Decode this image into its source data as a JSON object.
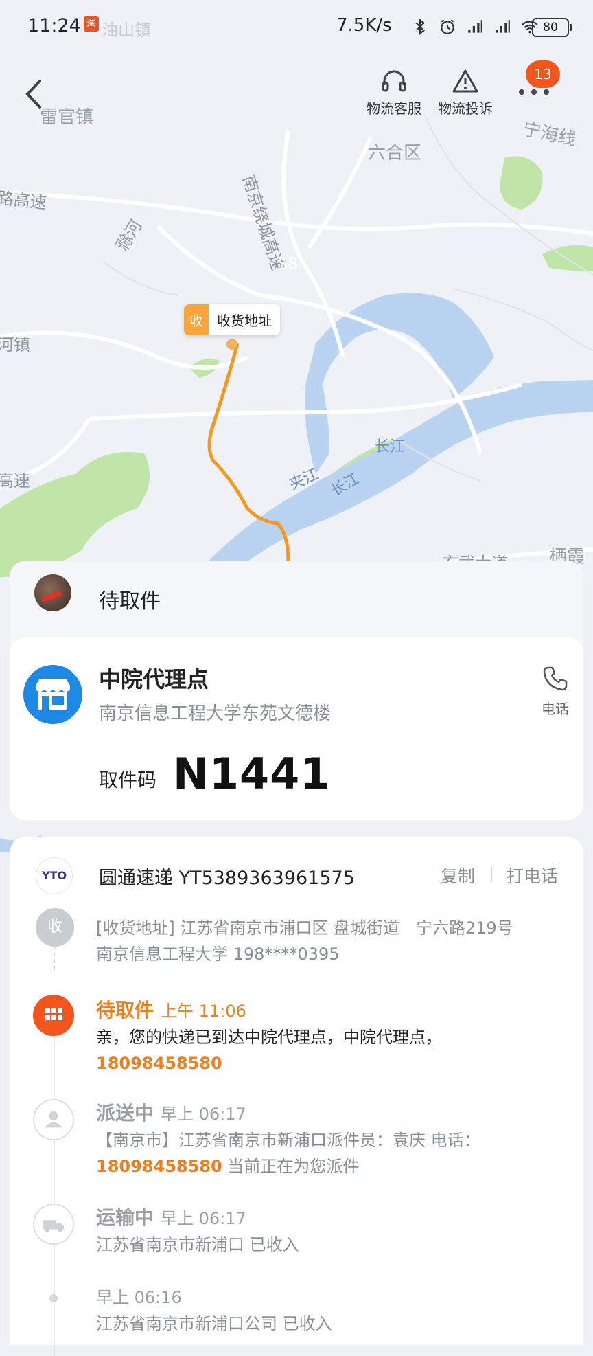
{
  "status_bar": {
    "time": "11:24",
    "app_icon": "淘",
    "faded_text": "油山镇",
    "net_speed": "7.5K/s",
    "battery": "80"
  },
  "nav": {
    "service_label": "物流客服",
    "complaint_label": "物流投诉",
    "badge_count": "13"
  },
  "map": {
    "labels": [
      "雷官镇",
      "南京绕城高速",
      "六合区",
      "宁海线",
      "路高速",
      "滁河",
      "S8",
      "河镇",
      "长江",
      "夹江",
      "长江",
      "高速",
      "栖霞",
      "玄武大道"
    ],
    "pin_tag": "收",
    "pin_text": "收货地址"
  },
  "status": {
    "title": "待取件"
  },
  "station": {
    "name": "中院代理点",
    "address": "南京信息工程大学东苑文德楼",
    "phone_label": "电话",
    "code_label": "取件码",
    "code": "N1441"
  },
  "tracking": {
    "carrier_logo": "YTO",
    "carrier": "圆通速递 YT5389363961575",
    "copy": "复制",
    "call": "打电话",
    "receive_tag": "收",
    "receive_line1": "[收货地址] 江苏省南京市浦口区 盘城街道　宁六路219号",
    "receive_line2": "南京信息工程大学 198****0395",
    "events": [
      {
        "title": "待取件",
        "time": "上午 11:06",
        "line1": "亲，您的快递已到达中院代理点，中院代理点，",
        "phone": "18098458580",
        "line2_suffix": ""
      },
      {
        "title": "派送中",
        "time": "早上 06:17",
        "line1": "【南京市】江苏省南京市新浦口派件员：袁庆 电话：",
        "phone": "18098458580",
        "line2_suffix": " 当前正在为您派件"
      },
      {
        "title": "运输中",
        "time": "早上 06:17",
        "line1": "江苏省南京市新浦口 已收入"
      },
      {
        "title": "",
        "time": "早上 06:16",
        "line1": "江苏省南京市新浦口公司 已收入"
      }
    ]
  },
  "colors": {
    "accent": "#f3561c",
    "route": "#f39a1e",
    "river": "#b9d3f0",
    "park": "#bfe6a8"
  }
}
